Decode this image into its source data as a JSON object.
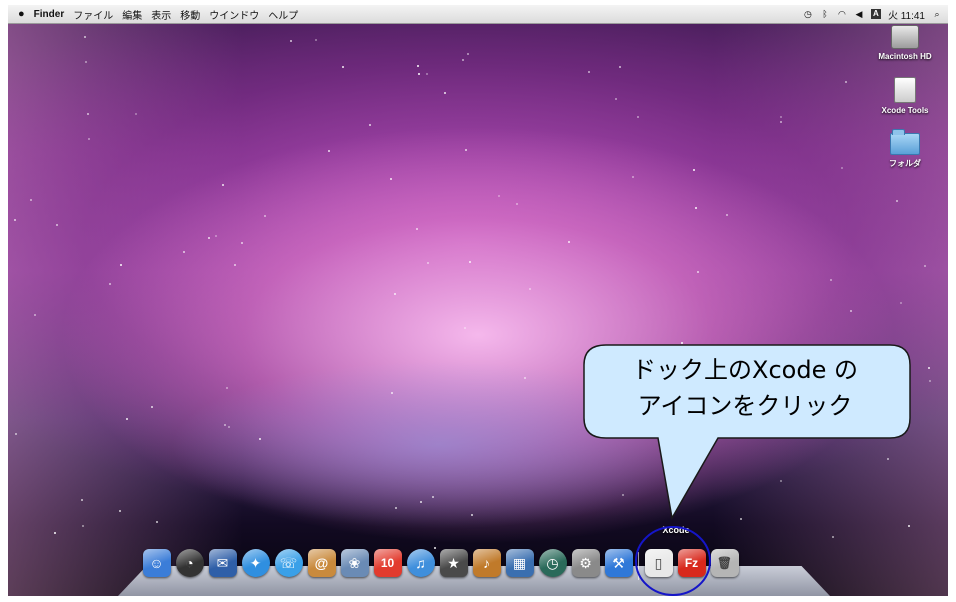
{
  "menubar": {
    "apple": "",
    "app_name": "Finder",
    "items": [
      "ファイル",
      "編集",
      "表示",
      "移動",
      "ウインドウ",
      "ヘルプ"
    ],
    "clock": "火 11:41",
    "input_method": "A"
  },
  "desktop_icons": [
    {
      "label": "Macintosh HD",
      "icon": "hard-drive-icon"
    },
    {
      "label": "Xcode Tools",
      "icon": "disk-image-icon"
    },
    {
      "label": "フォルダ",
      "icon": "folder-icon"
    }
  ],
  "dock": {
    "hover_label": "Xcode",
    "items": [
      {
        "name": "finder-icon",
        "color": "#3b7dd8",
        "glyph": "☺"
      },
      {
        "name": "dashboard-icon",
        "color": "#333333",
        "glyph": "◔"
      },
      {
        "name": "mail-stamp-icon",
        "color": "#2f5fa8",
        "glyph": "✉"
      },
      {
        "name": "safari-icon",
        "color": "#2f8fe0",
        "glyph": "✦"
      },
      {
        "name": "ichat-icon",
        "color": "#3aa0e8",
        "glyph": "☏"
      },
      {
        "name": "address-book-icon",
        "color": "#c98a3c",
        "glyph": "@"
      },
      {
        "name": "iphoto-icon",
        "color": "#6a8bb5",
        "glyph": "❀"
      },
      {
        "name": "ical-icon",
        "color": "#e23b2e",
        "glyph": "10"
      },
      {
        "name": "itunes-icon",
        "color": "#3f8fdc",
        "glyph": "♫"
      },
      {
        "name": "imovie-icon",
        "color": "#4a4a4a",
        "glyph": "★"
      },
      {
        "name": "garageband-icon",
        "color": "#c07a2a",
        "glyph": "♪"
      },
      {
        "name": "spaces-icon",
        "color": "#3a6fb0",
        "glyph": "▦"
      },
      {
        "name": "time-machine-icon",
        "color": "#2a6a5a",
        "glyph": "◷"
      },
      {
        "name": "system-preferences-icon",
        "color": "#8a8a8a",
        "glyph": "⚙"
      },
      {
        "name": "xcode-icon",
        "color": "#2f78d8",
        "glyph": "⚒"
      },
      {
        "name": "document-icon",
        "color": "#e8e8e8",
        "glyph": "▯"
      },
      {
        "name": "filezilla-icon",
        "color": "#d8281c",
        "glyph": "Fz"
      },
      {
        "name": "trash-icon",
        "color": "#b5b5b5",
        "glyph": "🗑"
      }
    ]
  },
  "callout": {
    "line1": "ドック上のXcode の",
    "line2": "アイコンをクリック",
    "fill": "#cfeaff",
    "highlight_color": "#1515c8"
  }
}
